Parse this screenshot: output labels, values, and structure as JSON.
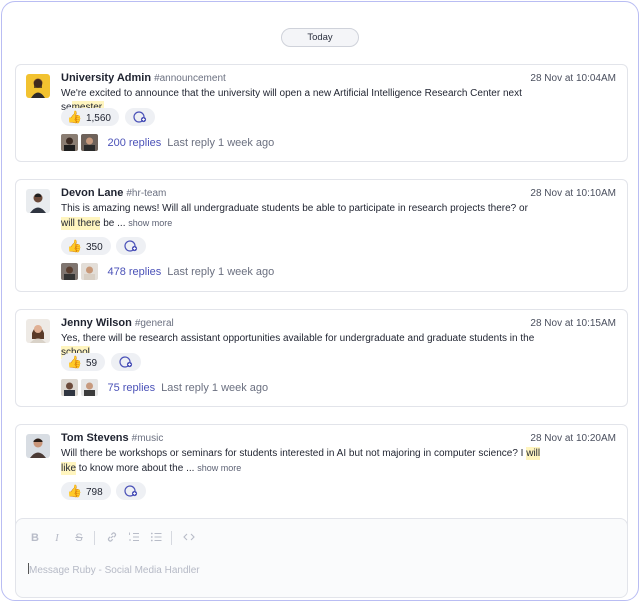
{
  "day_separator": "Today",
  "messages": [
    {
      "author": "University Admin",
      "channel": "#announcement",
      "time": "28 Nov at 10:04AM",
      "text_before": "We're excited to announce that the university will open a new Artificial Intelligence Research Center next se",
      "text_highlight": "mester.",
      "text_after": "",
      "show_more": "",
      "reaction_count": "1,560",
      "replies": "200 replies",
      "last_reply": "Last reply 1 week ago"
    },
    {
      "author": "Devon Lane",
      "channel": "#hr-team",
      "time": "28 Nov at 10:10AM",
      "text_before": "This is amazing news! Will all undergraduate students be able to participate in research projects there? or ",
      "text_highlight": "will there",
      "text_after": " be ...",
      "show_more": "show more",
      "reaction_count": "350",
      "replies": "478 replies",
      "last_reply": "Last reply 1 week ago"
    },
    {
      "author": "Jenny Wilson",
      "channel": "#general",
      "time": "28 Nov at 10:15AM",
      "text_before": "Yes, there will be research assistant opportunities available for undergraduate and graduate students in the ",
      "text_highlight": "school",
      "text_after": "",
      "show_more": "",
      "reaction_count": "59",
      "replies": "75 replies",
      "last_reply": "Last reply 1 week ago"
    },
    {
      "author": "Tom Stevens",
      "channel": "#music",
      "time": "28 Nov at 10:20AM",
      "text_before": "Will there be workshops or seminars for students interested in AI but not majoring in computer science? I ",
      "text_highlight": "will like",
      "text_after": " to know more about the ...",
      "show_more": "show more",
      "reaction_count": "798",
      "replies": "",
      "last_reply": ""
    }
  ],
  "composer": {
    "placeholder": "Message Ruby - Social Media Handler",
    "toolbar": [
      "bold-icon",
      "italic-icon",
      "strikethrough-icon",
      "link-icon",
      "ordered-list-icon",
      "bullet-list-icon",
      "code-icon"
    ]
  },
  "colors": {
    "frame_border": "#b9bdf3",
    "highlight": "#fff5bf",
    "reply_link": "#4b52b8"
  }
}
